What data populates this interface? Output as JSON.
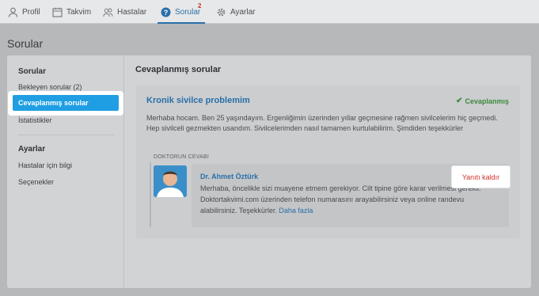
{
  "nav": {
    "items": [
      {
        "label": "Profil",
        "icon": "user-icon"
      },
      {
        "label": "Takvim",
        "icon": "calendar-icon"
      },
      {
        "label": "Hastalar",
        "icon": "users-icon"
      },
      {
        "label": "Sorular",
        "icon": "question-icon",
        "badge": "2",
        "active": true
      },
      {
        "label": "Ayarlar",
        "icon": "gear-icon"
      }
    ]
  },
  "page": {
    "title": "Sorular"
  },
  "sidebar": {
    "section1": "Sorular",
    "items1": [
      "Bekleyen sorular (2)",
      "Cevaplanmış sorular",
      "İstatistikler"
    ],
    "section2": "Ayarlar",
    "items2": [
      "Hastalar için bilgi",
      "Seçenekler"
    ]
  },
  "main": {
    "title": "Cevaplanmış sorular",
    "question": {
      "title": "Kronik sivilce problemim",
      "status": "Cevaplanmış",
      "body": "Merhaba hocam. Ben 25 yaşındayım. Ergenliğimin üzerinden yıllar geçmesine rağmen sivilcelerim hiç geçmedi. Hep sivilceli gezmekten usandım. Sivilcelerimden nasıl tamamen kurtulabilirim. Şimdiden teşekkürler"
    },
    "answer": {
      "label": "DOKTORUN CEVABI",
      "doctor": "Dr. Ahmet Öztürk",
      "text": "Merhaba, öncelikle sizi muayene etmem gerekiyor. Cilt tipine göre karar verilmesi gerekli. Doktortakvimi.com üzerinden telefon numarasını arayabilirsiniz veya online randevu alabilirsiniz. Teşekkürler.",
      "more": "Daha fazla"
    },
    "remove_button": "Yanıtı kaldır"
  },
  "colors": {
    "accent": "#2a6fa8",
    "highlight": "#1f9ee3",
    "success": "#3d8a3d",
    "danger": "#d0322b"
  }
}
